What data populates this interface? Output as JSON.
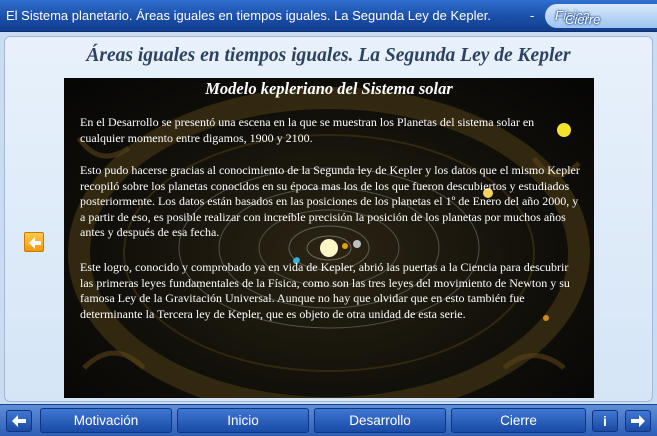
{
  "window": {
    "title": "El Sistema planetario. Áreas iguales en tiempos iguales. La Segunda Ley de Kepler.",
    "separator": "-",
    "tab_label": "Cierre",
    "tab_suffix": "Física"
  },
  "main": {
    "heading": "Áreas iguales en tiempos iguales. La Segunda Ley de Kepler"
  },
  "scene": {
    "title": "Modelo kepleriano del Sistema solar",
    "paragraphs": [
      "En el Desarrollo se presentó una escena en la que se muestran los Planetas del sistema solar en cualquier momento entre digamos, 1900 y 2100.",
      "Esto pudo hacerse gracias al conocimiento de la Segunda ley de Kepler y los datos que el mismo Kepler recopiló sobre los planetas conocidos en su época mas los de los que fueron descubiertos y estudiados posteriormente. Los datos están basados en las posiciones de los planetas el 1º de Enero del año 2000, y a partir de eso, es posible realizar con increíble precisión la posición de los planetas por muchos años antes y después de esa fecha.",
      "Este logro, conocido y comprobado ya en vida de Kepler, abrió las puertas a la Ciencia para descubrir las primeras leyes fundamentales de la Física, como son las tres leyes del movimiento de Newton y su famosa Ley de la Gravitación Universal. Aunque no hay que olvidar que  en esto también fue determinante la Tercera ley de Kepler, que es objeto de otra unidad de esta serie."
    ]
  },
  "nav": {
    "prev_icon": "arrow-left-icon",
    "next_icon": "arrow-right-icon",
    "info_label": "i",
    "buttons": [
      "Motivación",
      "Inicio",
      "Desarrollo",
      "Cierre"
    ]
  },
  "colors": {
    "titlebar": "#1a4fa8",
    "nav_button": "#2a5fbd",
    "heading": "#2d4260",
    "back_arrow": "#f5a623"
  }
}
